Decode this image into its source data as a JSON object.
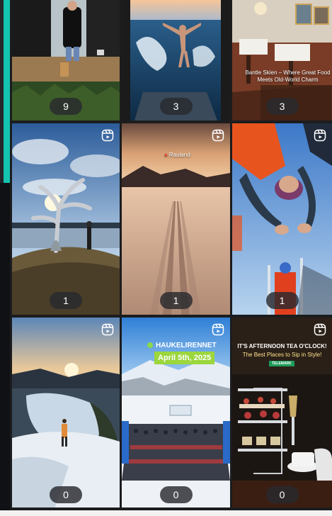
{
  "grid": {
    "tiles": [
      {
        "count": "9",
        "is_reel": false
      },
      {
        "count": "3",
        "is_reel": false
      },
      {
        "count": "3",
        "is_reel": false,
        "caption": "Bantle Skien – Where Great Food Meets Old-World Charm"
      },
      {
        "count": "1",
        "is_reel": true
      },
      {
        "count": "1",
        "is_reel": true,
        "location": "Rauland"
      },
      {
        "count": "1",
        "is_reel": true
      },
      {
        "count": "0",
        "is_reel": true
      },
      {
        "count": "0",
        "is_reel": true,
        "brand": "HAUKELIRENNET",
        "date": "April 5th, 2025"
      },
      {
        "count": "0",
        "is_reel": true,
        "title": "IT'S AFTERNOON TEA O'CLOCK!",
        "subtitle": "The Best Places to Sip in Style!",
        "tag": "TELEMARK"
      }
    ]
  },
  "icons": {
    "reel": "reels-icon"
  },
  "colors": {
    "accent_bar": "#14c4b0",
    "count_pill": "#282a2e"
  }
}
